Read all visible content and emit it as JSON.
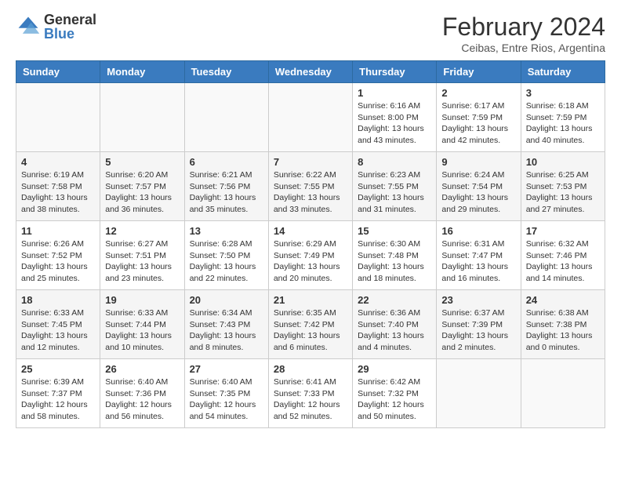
{
  "header": {
    "logo_general": "General",
    "logo_blue": "Blue",
    "month_year": "February 2024",
    "location": "Ceibas, Entre Rios, Argentina"
  },
  "days_of_week": [
    "Sunday",
    "Monday",
    "Tuesday",
    "Wednesday",
    "Thursday",
    "Friday",
    "Saturday"
  ],
  "weeks": [
    [
      {
        "day": "",
        "detail": ""
      },
      {
        "day": "",
        "detail": ""
      },
      {
        "day": "",
        "detail": ""
      },
      {
        "day": "",
        "detail": ""
      },
      {
        "day": "1",
        "detail": "Sunrise: 6:16 AM\nSunset: 8:00 PM\nDaylight: 13 hours\nand 43 minutes."
      },
      {
        "day": "2",
        "detail": "Sunrise: 6:17 AM\nSunset: 7:59 PM\nDaylight: 13 hours\nand 42 minutes."
      },
      {
        "day": "3",
        "detail": "Sunrise: 6:18 AM\nSunset: 7:59 PM\nDaylight: 13 hours\nand 40 minutes."
      }
    ],
    [
      {
        "day": "4",
        "detail": "Sunrise: 6:19 AM\nSunset: 7:58 PM\nDaylight: 13 hours\nand 38 minutes."
      },
      {
        "day": "5",
        "detail": "Sunrise: 6:20 AM\nSunset: 7:57 PM\nDaylight: 13 hours\nand 36 minutes."
      },
      {
        "day": "6",
        "detail": "Sunrise: 6:21 AM\nSunset: 7:56 PM\nDaylight: 13 hours\nand 35 minutes."
      },
      {
        "day": "7",
        "detail": "Sunrise: 6:22 AM\nSunset: 7:55 PM\nDaylight: 13 hours\nand 33 minutes."
      },
      {
        "day": "8",
        "detail": "Sunrise: 6:23 AM\nSunset: 7:55 PM\nDaylight: 13 hours\nand 31 minutes."
      },
      {
        "day": "9",
        "detail": "Sunrise: 6:24 AM\nSunset: 7:54 PM\nDaylight: 13 hours\nand 29 minutes."
      },
      {
        "day": "10",
        "detail": "Sunrise: 6:25 AM\nSunset: 7:53 PM\nDaylight: 13 hours\nand 27 minutes."
      }
    ],
    [
      {
        "day": "11",
        "detail": "Sunrise: 6:26 AM\nSunset: 7:52 PM\nDaylight: 13 hours\nand 25 minutes."
      },
      {
        "day": "12",
        "detail": "Sunrise: 6:27 AM\nSunset: 7:51 PM\nDaylight: 13 hours\nand 23 minutes."
      },
      {
        "day": "13",
        "detail": "Sunrise: 6:28 AM\nSunset: 7:50 PM\nDaylight: 13 hours\nand 22 minutes."
      },
      {
        "day": "14",
        "detail": "Sunrise: 6:29 AM\nSunset: 7:49 PM\nDaylight: 13 hours\nand 20 minutes."
      },
      {
        "day": "15",
        "detail": "Sunrise: 6:30 AM\nSunset: 7:48 PM\nDaylight: 13 hours\nand 18 minutes."
      },
      {
        "day": "16",
        "detail": "Sunrise: 6:31 AM\nSunset: 7:47 PM\nDaylight: 13 hours\nand 16 minutes."
      },
      {
        "day": "17",
        "detail": "Sunrise: 6:32 AM\nSunset: 7:46 PM\nDaylight: 13 hours\nand 14 minutes."
      }
    ],
    [
      {
        "day": "18",
        "detail": "Sunrise: 6:33 AM\nSunset: 7:45 PM\nDaylight: 13 hours\nand 12 minutes."
      },
      {
        "day": "19",
        "detail": "Sunrise: 6:33 AM\nSunset: 7:44 PM\nDaylight: 13 hours\nand 10 minutes."
      },
      {
        "day": "20",
        "detail": "Sunrise: 6:34 AM\nSunset: 7:43 PM\nDaylight: 13 hours\nand 8 minutes."
      },
      {
        "day": "21",
        "detail": "Sunrise: 6:35 AM\nSunset: 7:42 PM\nDaylight: 13 hours\nand 6 minutes."
      },
      {
        "day": "22",
        "detail": "Sunrise: 6:36 AM\nSunset: 7:40 PM\nDaylight: 13 hours\nand 4 minutes."
      },
      {
        "day": "23",
        "detail": "Sunrise: 6:37 AM\nSunset: 7:39 PM\nDaylight: 13 hours\nand 2 minutes."
      },
      {
        "day": "24",
        "detail": "Sunrise: 6:38 AM\nSunset: 7:38 PM\nDaylight: 13 hours\nand 0 minutes."
      }
    ],
    [
      {
        "day": "25",
        "detail": "Sunrise: 6:39 AM\nSunset: 7:37 PM\nDaylight: 12 hours\nand 58 minutes."
      },
      {
        "day": "26",
        "detail": "Sunrise: 6:40 AM\nSunset: 7:36 PM\nDaylight: 12 hours\nand 56 minutes."
      },
      {
        "day": "27",
        "detail": "Sunrise: 6:40 AM\nSunset: 7:35 PM\nDaylight: 12 hours\nand 54 minutes."
      },
      {
        "day": "28",
        "detail": "Sunrise: 6:41 AM\nSunset: 7:33 PM\nDaylight: 12 hours\nand 52 minutes."
      },
      {
        "day": "29",
        "detail": "Sunrise: 6:42 AM\nSunset: 7:32 PM\nDaylight: 12 hours\nand 50 minutes."
      },
      {
        "day": "",
        "detail": ""
      },
      {
        "day": "",
        "detail": ""
      }
    ]
  ]
}
